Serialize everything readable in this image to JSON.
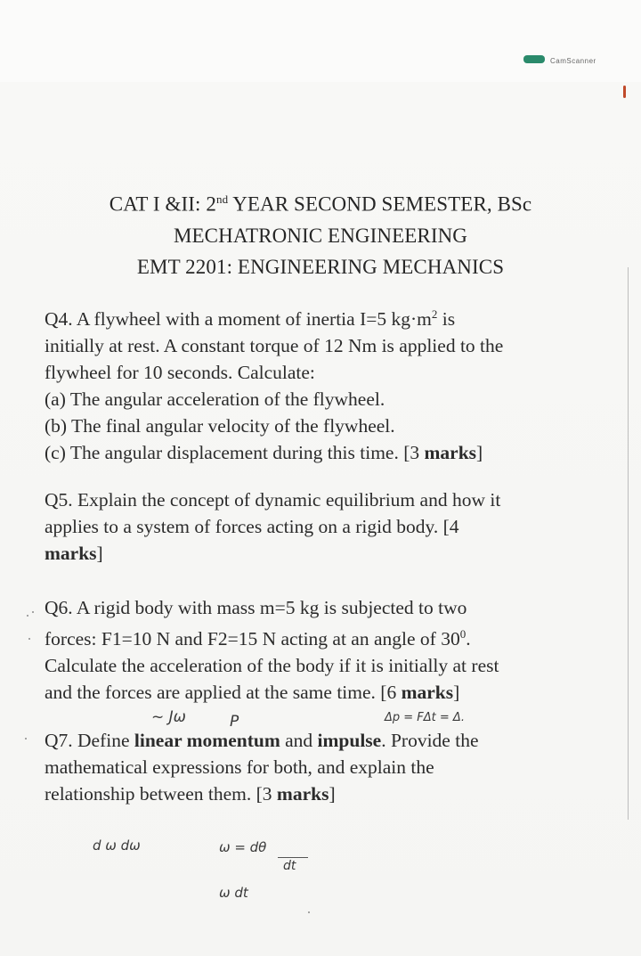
{
  "header": {
    "line1_a": "CAT I &II: 2",
    "line1_sup": "nd",
    "line1_b": " YEAR SECOND SEMESTER, BSc",
    "line2": "MECHATRONIC ENGINEERING",
    "line3": "EMT 2201: ENGINEERING MECHANICS"
  },
  "q4": {
    "l1_a": "Q4. A flywheel with a moment of inertia I=5 kg·m",
    "l1_sup": "2",
    "l1_b": " is",
    "l2": "initially at rest. A constant torque of 12 Nm is applied to the",
    "l3": "flywheel for 10 seconds. Calculate:",
    "l4": "(a) The angular acceleration of the flywheel.",
    "l5": "(b) The final angular velocity of the flywheel.",
    "l6_a": "(c) The angular displacement during this time. [3 ",
    "l6_b": "marks",
    "l6_c": "]"
  },
  "q5": {
    "l1": "Q5. Explain the concept of dynamic equilibrium and how it",
    "l2": "applies to a system of forces acting on a rigid body. [4",
    "l3_b": "marks",
    "l3_c": "]"
  },
  "q6": {
    "l1": "Q6. A rigid body with mass m=5 kg is subjected to two",
    "l2_a": "forces: F1=10 N and F2=15 N acting at an angle of 30",
    "l2_sup": "0",
    "l2_b": ".",
    "l3": "Calculate the acceleration of the body if it is initially at rest",
    "l4_a": "and the forces are applied at the same time. [6 ",
    "l4_b": "marks",
    "l4_c": "]"
  },
  "q7": {
    "l1_a": "Q7. Define ",
    "l1_b": "linear momentum",
    "l1_c": " and ",
    "l1_d": "impulse",
    "l1_e": ". Provide the",
    "l2": "mathematical expressions for both, and explain the",
    "l3_a": "relationship between them. [3 ",
    "l3_b": "marks",
    "l3_c": "]"
  },
  "handwriting": {
    "a": "~ Jω",
    "b": "P",
    "c": "Δp = FΔt = Δ.",
    "d": "d ω dω",
    "e": "ω = dθ",
    "f": "dt",
    "g": "ω dt"
  },
  "scanner": {
    "text": "CamScanner"
  }
}
